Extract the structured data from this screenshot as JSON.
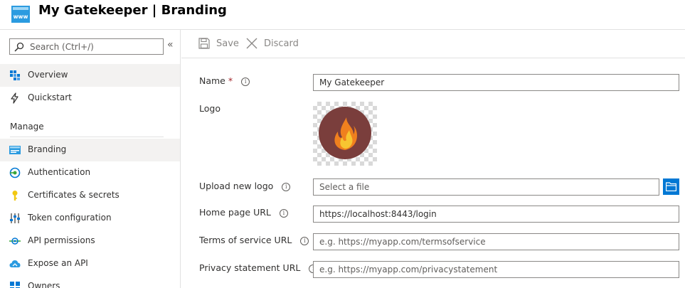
{
  "header": {
    "title": "My Gatekeeper | Branding",
    "icon": "www-icon"
  },
  "search": {
    "placeholder": "Search (Ctrl+/)",
    "collapse_label": "«"
  },
  "sidebar": {
    "top_items": [
      {
        "label": "Overview",
        "icon": "overview-grid-icon"
      },
      {
        "label": "Quickstart",
        "icon": "lightning-icon"
      }
    ],
    "section_label": "Manage",
    "manage_items": [
      {
        "label": "Branding",
        "icon": "branding-icon",
        "active": true
      },
      {
        "label": "Authentication",
        "icon": "authentication-icon"
      },
      {
        "label": "Certificates & secrets",
        "icon": "key-icon"
      },
      {
        "label": "Token configuration",
        "icon": "token-bars-icon"
      },
      {
        "label": "API permissions",
        "icon": "api-permissions-icon"
      },
      {
        "label": "Expose an API",
        "icon": "cloud-icon"
      },
      {
        "label": "Owners",
        "icon": "owners-icon"
      }
    ]
  },
  "toolbar": {
    "save_label": "Save",
    "discard_label": "Discard"
  },
  "form": {
    "name_label": "Name",
    "name_required": "*",
    "name_value": "My Gatekeeper",
    "logo_label": "Logo",
    "upload_label": "Upload new logo",
    "upload_placeholder": "Select a file",
    "homepage_label": "Home page URL",
    "homepage_value": "https://localhost:8443/login",
    "terms_label": "Terms of service URL",
    "terms_placeholder": "e.g. https://myapp.com/termsofservice",
    "privacy_label": "Privacy statement URL",
    "privacy_placeholder": "e.g. https://myapp.com/privacystatement",
    "info_glyph": "i"
  },
  "colors": {
    "accent": "#0078d4",
    "required": "#a4262c",
    "logo_bg": "#7a3e3c",
    "flame": "#f0801e"
  }
}
